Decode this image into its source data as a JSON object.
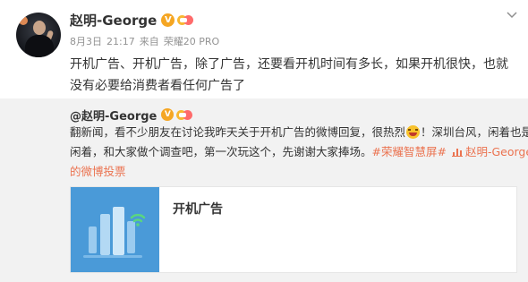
{
  "post": {
    "author": "赵明-George",
    "verified_badge": "V",
    "meta": {
      "date": "8月3日",
      "time": "21:17",
      "source_prefix": "来自",
      "source": "荣耀20 PRO"
    },
    "text_lines": [
      "开机广告、开机广告，除了广告，还要看开机时间有多长，如果开机很快，也就",
      "没有必要给消费者看任何广告了"
    ]
  },
  "repost": {
    "author": "@赵明-George",
    "verified_badge": "V",
    "line1": "翻新闻，看不少朋友在讨论我昨天关于开机广告的微博回复，很热烈",
    "line1_tail": "！深圳台风，闲着也是",
    "line2_pre": "闲着，和大家做个调查吧，第一次玩这个，先谢谢大家捧场。",
    "hashtag": "#荣耀智慧屏#",
    "link_author": "赵明-George",
    "line3_link": "的微博投票",
    "card": {
      "title": "开机广告"
    }
  },
  "colors": {
    "link": "#eb7350",
    "repost_bg": "#f2f2f2",
    "card_thumb": "#4a9ad8",
    "badge": "#f5a623"
  },
  "icons": {
    "more": "chevron-down-icon",
    "emoji": "grin-emoji-icon",
    "link_icon": "vote-chart-icon",
    "card_image": "tv-bars-wifi-icon"
  }
}
